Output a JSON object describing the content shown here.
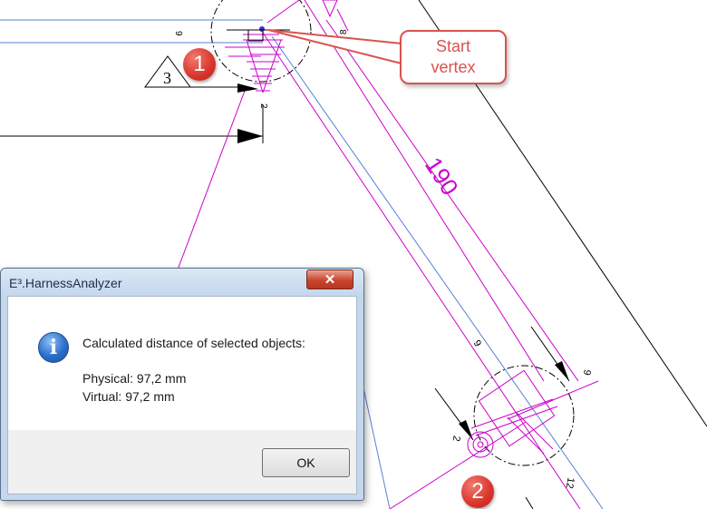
{
  "drawing": {
    "dimension_value": "190",
    "triangle_label": "3",
    "dim_small_top": "9",
    "dim_small_right": "8",
    "dim_small_bottom": "2",
    "dim_lower_9": "9",
    "dim_lower_6": "6",
    "dim_lower_12": "12",
    "dim_lower_2": "2"
  },
  "callout": {
    "line1": "Start",
    "line2": "vertex"
  },
  "markers": {
    "one": "1",
    "two": "2"
  },
  "dialog": {
    "title": "E³.HarnessAnalyzer",
    "close_glyph": "✕",
    "icon": "info-icon",
    "heading": "Calculated distance of selected objects:",
    "physical": "Physical: 97,2 mm",
    "virtual": "Virtual: 97,2 mm",
    "ok_label": "OK"
  },
  "colors": {
    "magenta": "#cc00cc",
    "blue_line": "#5b7fd6",
    "callout_red": "#d9534f",
    "dialog_frame": "#c4d7ec"
  }
}
